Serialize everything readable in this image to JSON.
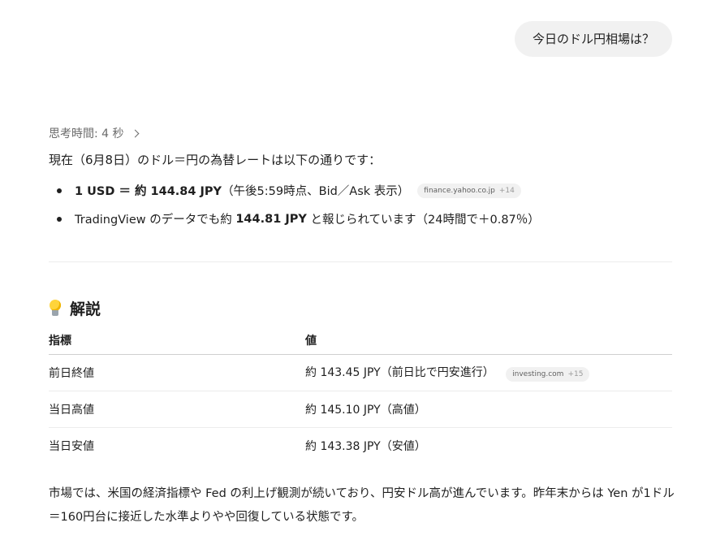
{
  "user_message": "今日のドル円相場は？",
  "thinking": {
    "label": "思考時間: 4 秒"
  },
  "intro": "現在（6月8日）のドル＝円の為替レートは以下の通りです：",
  "bullets": [
    {
      "bold": "1 USD ＝ 約 144.84 JPY",
      "rest": "（午後5:59時点、Bid／Ask 表示）",
      "source": {
        "name": "finance.yahoo.co.jp",
        "more": "+14"
      }
    },
    {
      "pre": "TradingView のデータでも約 ",
      "bold": "144.81 JPY",
      "post": " と報じられています（24時間で＋0.87％）"
    }
  ],
  "section": {
    "icon": "lightbulb-icon",
    "title": "解説"
  },
  "table": {
    "headers": [
      "指標",
      "値"
    ],
    "rows": [
      {
        "label": "前日終値",
        "value": "約 143.45 JPY（前日比で円安進行）",
        "source": {
          "name": "investing.com",
          "more": "+15"
        }
      },
      {
        "label": "当日高値",
        "value": "約 145.10 JPY（高値）"
      },
      {
        "label": "当日安値",
        "value": "約 143.38 JPY（安値）"
      }
    ]
  },
  "summary": "市場では、米国の経済指標や Fed の利上げ観測が続いており、円安ドル高が進んでいます。昨年末からは Yen が1ドル＝160円台に接近した水準よりやや回復している状態です。",
  "colors": {
    "bubble_bg": "#f1f1f1",
    "muted_text": "#6b6b6b",
    "chip_bg": "#f1f1f1"
  }
}
